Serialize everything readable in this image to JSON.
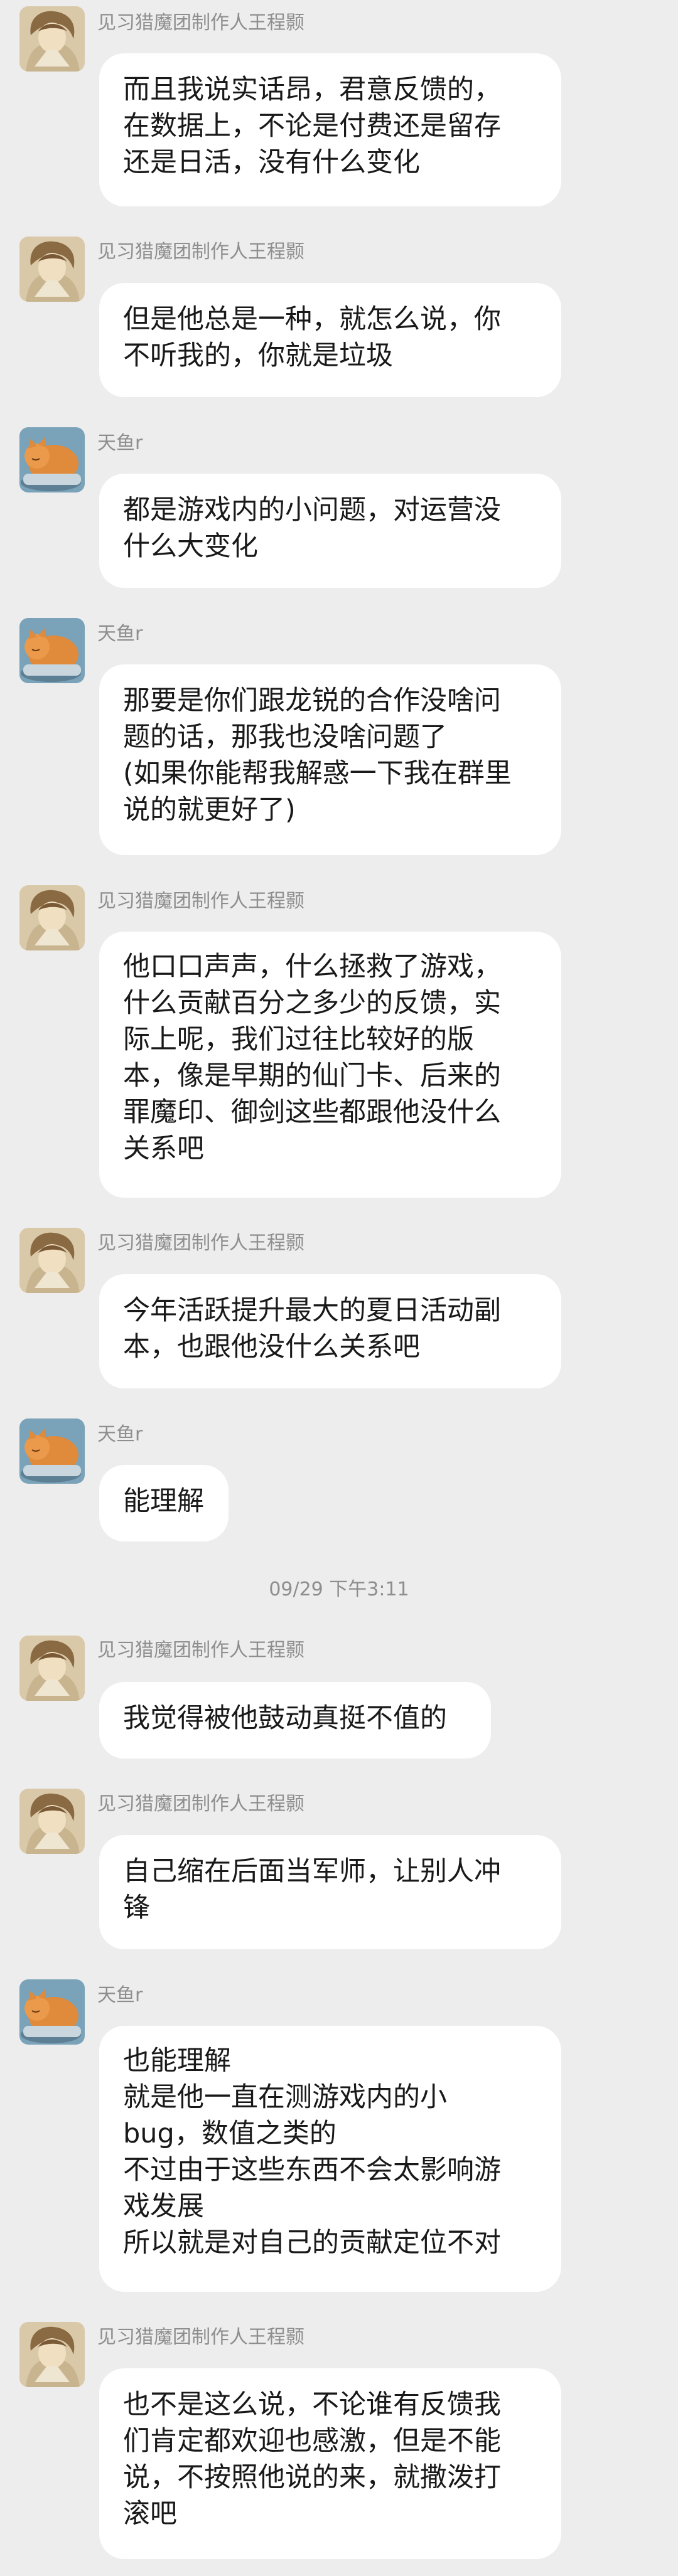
{
  "senders": {
    "wang": "见习猎魔团制作人王程颢",
    "tianyu": "天鱼r"
  },
  "timestamp": "09/29 下午3:11",
  "messages": [
    {
      "sender": "见习猎魔团制作人王程颢",
      "lines": [
        "而且我说实话昂，君意反馈的，",
        "在数据上，不论是付费还是留存",
        "还是日活，没有什么变化"
      ]
    },
    {
      "sender": "见习猎魔团制作人王程颢",
      "lines": [
        "但是他总是一种，就怎么说，你",
        "不听我的，你就是垃圾"
      ]
    },
    {
      "sender": "天鱼r",
      "lines": [
        "都是游戏内的小问题，对运营没",
        "什么大变化"
      ]
    },
    {
      "sender": "天鱼r",
      "lines": [
        "那要是你们跟龙锐的合作没啥问",
        "题的话，那我也没啥问题了",
        "(如果你能帮我解惑一下我在群里",
        "说的就更好了)"
      ]
    },
    {
      "sender": "见习猎魔团制作人王程颢",
      "lines": [
        "他口口声声，什么拯救了游戏，",
        "什么贡献百分之多少的反馈，实",
        "际上呢，我们过往比较好的版",
        "本，像是早期的仙门卡、后来的",
        "罪魔印、御剑这些都跟他没什么",
        "关系吧"
      ]
    },
    {
      "sender": "见习猎魔团制作人王程颢",
      "lines": [
        "今年活跃提升最大的夏日活动副",
        "本，也跟他没什么关系吧"
      ]
    },
    {
      "sender": "天鱼r",
      "lines": [
        "能理解"
      ]
    },
    {
      "sender": "见习猎魔团制作人王程颢",
      "lines": [
        "我觉得被他鼓动真挺不值的"
      ]
    },
    {
      "sender": "见习猎魔团制作人王程颢",
      "lines": [
        "自己缩在后面当军师，让别人冲",
        "锋"
      ]
    },
    {
      "sender": "天鱼r",
      "lines": [
        "也能理解",
        "就是他一直在测游戏内的小",
        "bug，数值之类的",
        "不过由于这些东西不会太影响游",
        "戏发展",
        "所以就是对自己的贡献定位不对"
      ]
    },
    {
      "sender": "见习猎魔团制作人王程颢",
      "lines": [
        "也不是这么说，不论谁有反馈我",
        "们肯定都欢迎也感激，但是不能",
        "说，不按照他说的来，就撒泼打",
        "滚吧"
      ]
    }
  ]
}
